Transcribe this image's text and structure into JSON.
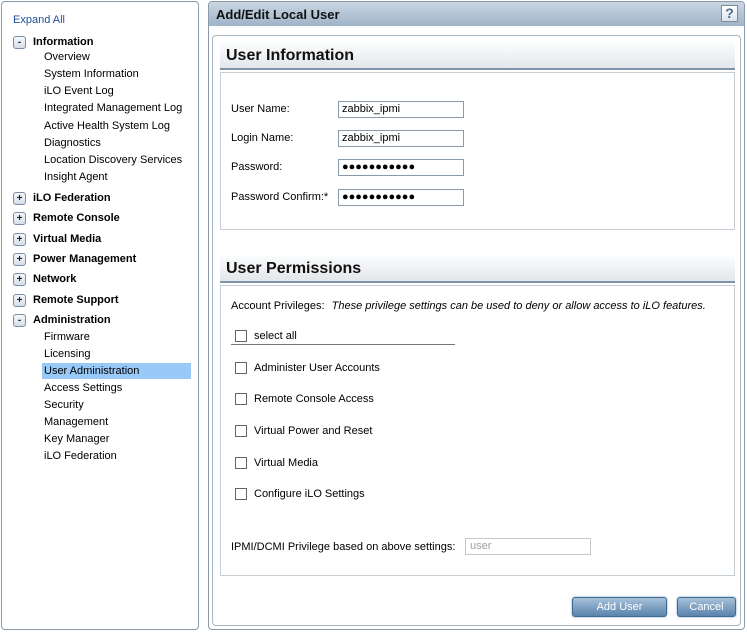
{
  "sidebar": {
    "expand_all": "Expand All",
    "groups": [
      {
        "label": "Information",
        "toggle": "-",
        "items": [
          "Overview",
          "System Information",
          "iLO Event Log",
          "Integrated Management Log",
          "Active Health System Log",
          "Diagnostics",
          "Location Discovery Services",
          "Insight Agent"
        ]
      },
      {
        "label": "iLO Federation",
        "toggle": "+"
      },
      {
        "label": "Remote Console",
        "toggle": "+"
      },
      {
        "label": "Virtual Media",
        "toggle": "+"
      },
      {
        "label": "Power Management",
        "toggle": "+"
      },
      {
        "label": "Network",
        "toggle": "+"
      },
      {
        "label": "Remote Support",
        "toggle": "+"
      },
      {
        "label": "Administration",
        "toggle": "-",
        "items": [
          "Firmware",
          "Licensing",
          "User Administration",
          "Access Settings",
          "Security",
          "Management",
          "Key Manager",
          "iLO Federation"
        ]
      }
    ],
    "selected_item": "User Administration"
  },
  "header": {
    "title": "Add/Edit Local User",
    "help_icon": "?"
  },
  "user_info": {
    "title": "User Information",
    "fields": [
      {
        "label": "User Name:",
        "value": "zabbix_ipmi"
      },
      {
        "label": "Login Name:",
        "value": "zabbix_ipmi"
      },
      {
        "label": "Password:",
        "value": "●●●●●●●●●●●"
      },
      {
        "label": "Password Confirm:*",
        "value": "●●●●●●●●●●●"
      }
    ]
  },
  "permissions": {
    "title": "User Permissions",
    "account_privileges_label": "Account Privileges:",
    "account_privileges_note": "These privilege settings can be used to deny or allow access to iLO features.",
    "select_all": "select all",
    "privileges": [
      "Administer User Accounts",
      "Remote Console Access",
      "Virtual Power and Reset",
      "Virtual Media",
      "Configure iLO Settings"
    ],
    "ipmi_label": "IPMI/DCMI Privilege based on above settings:",
    "ipmi_value": "user"
  },
  "actions": {
    "add_user": "Add User",
    "cancel": "Cancel"
  }
}
